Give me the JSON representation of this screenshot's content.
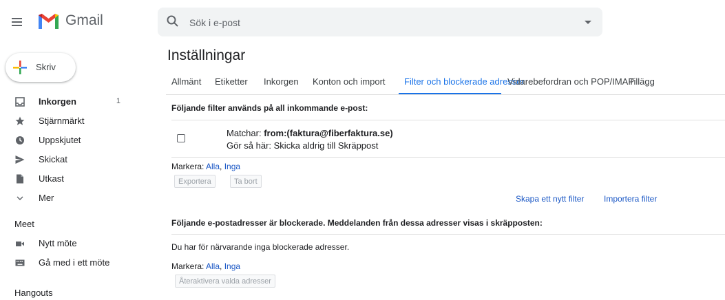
{
  "app": {
    "name": "Gmail",
    "brand_colors": {
      "red": "#ea4335",
      "blue": "#4285f4",
      "green": "#34a853",
      "yellow": "#fbbc04"
    }
  },
  "search": {
    "placeholder": "Sök i e-post",
    "value": ""
  },
  "compose": {
    "label": "Skriv",
    "icon": "plus-icon"
  },
  "sidebar": {
    "items": [
      {
        "label": "Inkorgen",
        "count": "1",
        "icon": "inbox-icon",
        "bold": true
      },
      {
        "label": "Stjärnmärkt",
        "icon": "star-icon"
      },
      {
        "label": "Uppskjutet",
        "icon": "clock-icon"
      },
      {
        "label": "Skickat",
        "icon": "send-icon"
      },
      {
        "label": "Utkast",
        "icon": "draft-icon"
      },
      {
        "label": "Mer",
        "icon": "chevron-down-icon"
      }
    ],
    "meet": {
      "title": "Meet",
      "items": [
        {
          "label": "Nytt möte",
          "icon": "video-icon"
        },
        {
          "label": "Gå med i ett möte",
          "icon": "keyboard-icon"
        }
      ]
    },
    "hangouts": {
      "title": "Hangouts"
    }
  },
  "settings": {
    "title": "Inställningar",
    "tabs": [
      {
        "label": "Allmänt"
      },
      {
        "label": "Etiketter"
      },
      {
        "label": "Inkorgen"
      },
      {
        "label": "Konton och import"
      },
      {
        "label": "Filter och blockerade adresser",
        "active": true
      },
      {
        "label": "Vidarebefordran och POP/IMAP"
      },
      {
        "label": "Tillägg"
      }
    ],
    "filters": {
      "heading": "Följande filter används på all inkommande e-post:",
      "items": [
        {
          "match_label": "Matchar: ",
          "match_value": "from:(faktura@fiberfaktura.se)",
          "action": "Gör så här: Skicka aldrig till Skräppost"
        }
      ],
      "select_label": "Markera: ",
      "select_all": "Alla",
      "select_sep": ", ",
      "select_none": "Inga",
      "export_button": "Exportera",
      "delete_button": "Ta bort",
      "create_filter_link": "Skapa ett nytt filter",
      "import_filter_link": "Importera filter"
    },
    "blocked": {
      "heading": "Följande e-postadresser är blockerade. Meddelanden från dessa adresser visas i skräpposten:",
      "empty_text": "Du har för närvarande inga blockerade adresser.",
      "select_label": "Markera: ",
      "select_all": "Alla",
      "select_sep": ", ",
      "select_none": "Inga",
      "unblock_button": "Återaktivera valda adresser"
    }
  }
}
